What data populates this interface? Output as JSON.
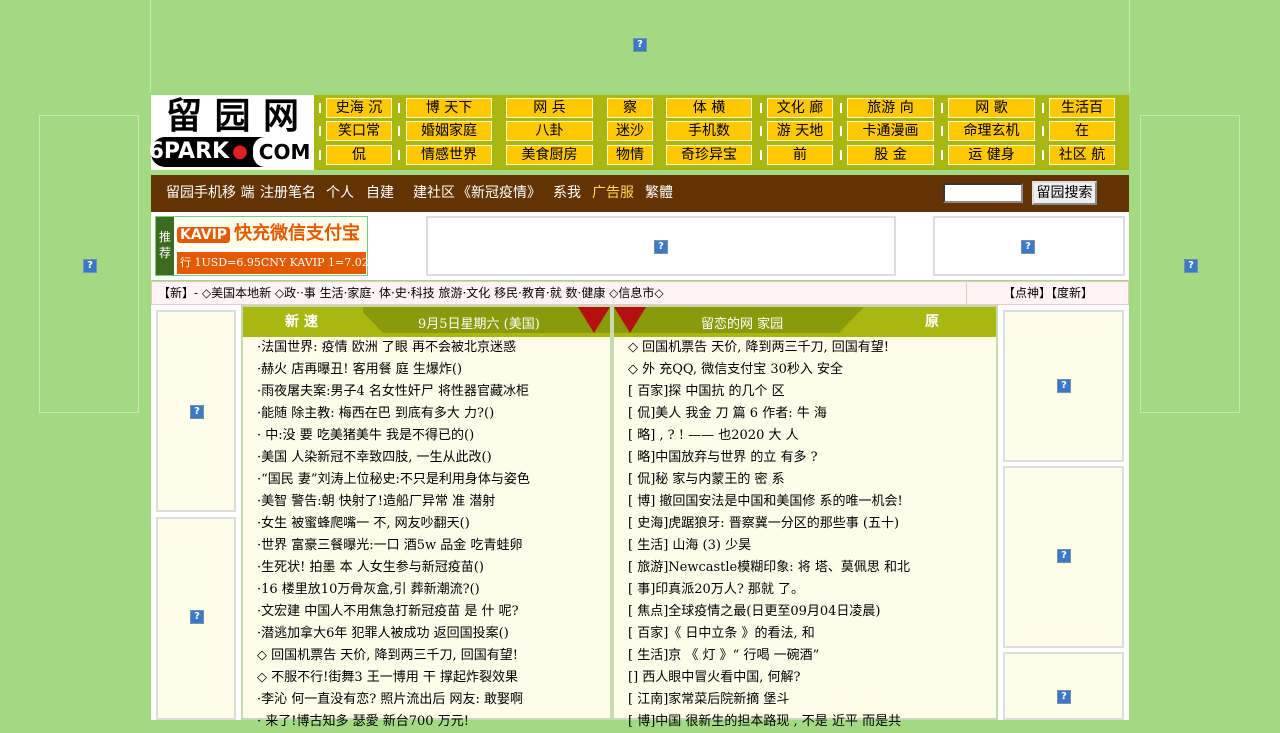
{
  "logo": {
    "top": "留 园 网",
    "brand": "6PARK",
    "com": "COM"
  },
  "nav": {
    "row1": [
      "史海 沉",
      "博 天下",
      "网 兵",
      "察",
      "体 横",
      "文化 廊",
      "旅游 向",
      "网 歌",
      "生活百"
    ],
    "row2": [
      "笑口常",
      "婚姻家庭",
      "八卦",
      "迷沙",
      "手机数",
      "游 天地",
      "卡通漫画",
      "命理玄机",
      "在"
    ],
    "row3": [
      "侃",
      "情感世界",
      "美食厨房",
      "物情",
      "奇珍异宝",
      "前",
      "股 金",
      "运 健身",
      "社区 航"
    ]
  },
  "menubar": {
    "items": [
      "留园手机移 端",
      "注册笔名",
      "个人",
      "自建",
      "建社区",
      "《新冠疫情》",
      "系我",
      "广告服",
      "繁體"
    ],
    "search_button": "留园搜索"
  },
  "promo": {
    "tui": "推 荐",
    "kavip_tag": "KAVIP",
    "kavip_text": "快充微信支付宝",
    "rate": "行 1USD=6.95CNY KAVIP 1=7.02"
  },
  "ticker": {
    "text": "【新】- ◇美国本地新 ◇政··事 生活·家庭· 体·史·科技 旅游·文化 移民·教育·就 数·健康 ◇信息市◇",
    "right": "【点神】【度新】"
  },
  "columns": {
    "left_title": "新 速",
    "left_date": "9月5日星期六 (美国)",
    "right_sub": "留恋的网 家园",
    "right_title": "原"
  },
  "left_news": [
    "·法国世界: 疫情 欧洲 了眼 再不会被北京迷惑",
    "·赫火 店再曝丑! 客用餐 庭 生爆炸()",
    "·雨夜屠夫案:男子4 名女性奸尸 将性器官藏冰柜",
    "·能随 除主教: 梅西在巴 到底有多大 力?()",
    "· 中:没 要 吃美猪美牛 我是不得已的()",
    "·美国 人染新冠不幸致四肢, 一生从此改()",
    "·“国民 妻”刘涛上位秘史:不只是利用身体与姿色",
    "·美智 警告:朝 快射了!造船厂异常 准 潜射",
    "·女生 被蜜蜂爬嘴一 不, 网友吵翻天()",
    "·世界 富豪三餐曝光:一口 酒5w 品金 吃青蛙卵",
    "·生死状! 拍墨 本 人女生参与新冠疫苗()",
    "·16 楼里放10万骨灰盒,引 葬新潮流?()",
    "·文宏建 中国人不用焦急打新冠疫苗 是 什 呢?",
    "·潜逃加拿大6年 犯罪人被成功 返回国投案()",
    "◇ 回国机票告 天价, 降到两三千刀, 回国有望!",
    "◇ 不服不行!街舞3 王一博用 干 撑起炸裂效果",
    "·李沁 何一直没有恋? 照片流出后 网友: 敢娶啊",
    "· 来了!博古知多 瑟愛 新台700 万元!"
  ],
  "right_news": [
    "◇ 回国机票告 天价, 降到两三千刀, 回国有望!",
    "◇ 外 充QQ, 微信支付宝 30秒入 安全",
    "[ 百家]探 中国抗 的几个 区",
    "[ 侃]美人 我金 刀 篇 6 作者: 牛 海",
    "[ 略] , ? ! —— 也2020 大 人",
    "[ 略]中国放弃与世界 的立 有多 ?",
    "[ 侃]秘 家与内蒙王的 密 系",
    "[ 博] 撤回国安法是中国和美国修 系的唯一机会!",
    "[ 史海]虎踞狼牙: 晋察冀一分区的那些事 (五十)",
    "[ 生活] 山海 (3) 少昊",
    "[ 旅游]Newcastle模糊印象: 将 塔、莫佩思 和北",
    "[ 事]印真派20万人? 那就 了。",
    "[ 焦点]全球疫情之最(日更至09月04日凌晨)",
    "[ 百家]《 日中立条 》的看法, 和",
    "[ 生活]京 《 灯 》“ 行喝 一碗酒”",
    "[] 西人眼中冒火看中国, 何解?",
    "[ 江南]家常菜后院新摘 堡斗",
    "[ 博]中国 很新生的担本路现 , 不是 近平 而是共"
  ]
}
